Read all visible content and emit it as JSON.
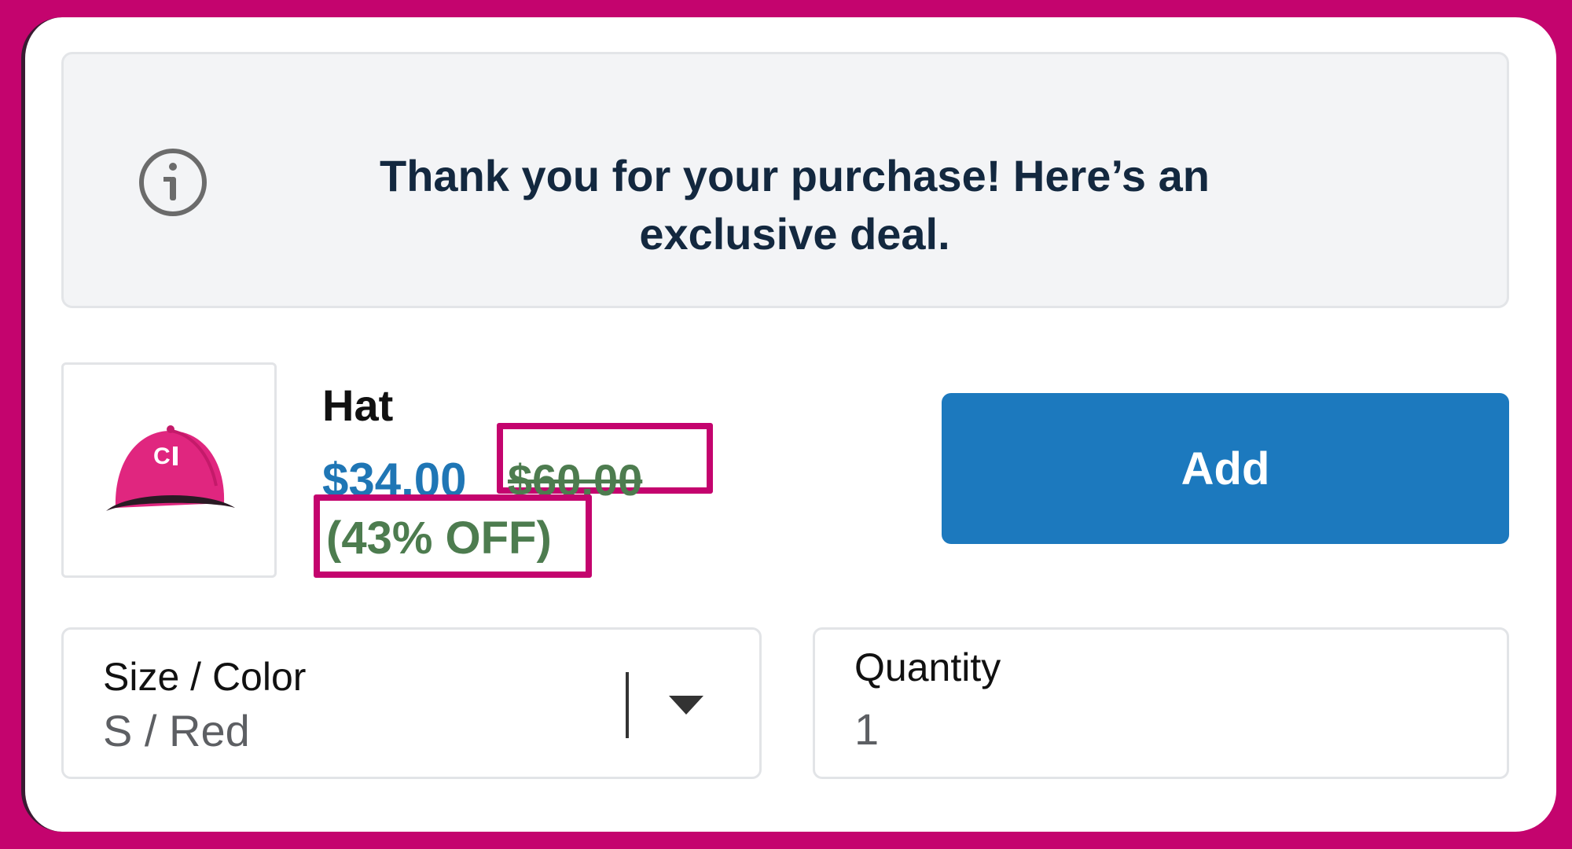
{
  "banner": {
    "message": "Thank you for your purchase! Here’s an exclusive deal.",
    "icon": "info-icon"
  },
  "product": {
    "name": "Hat",
    "price": "$34.00",
    "compare_price": "$60.00",
    "discount": "(43% OFF)",
    "image_icon": "pink-cap-image",
    "add_label": "Add"
  },
  "variant_select": {
    "label": "Size / Color",
    "value": "S / Red",
    "icon": "chevron-down-icon"
  },
  "quantity": {
    "label": "Quantity",
    "value": "1"
  },
  "colors": {
    "frame": "#c4046e",
    "button": "#1c79be",
    "price": "#1f76b5",
    "discount": "#4d7c4f",
    "cap": "#e0267f"
  }
}
